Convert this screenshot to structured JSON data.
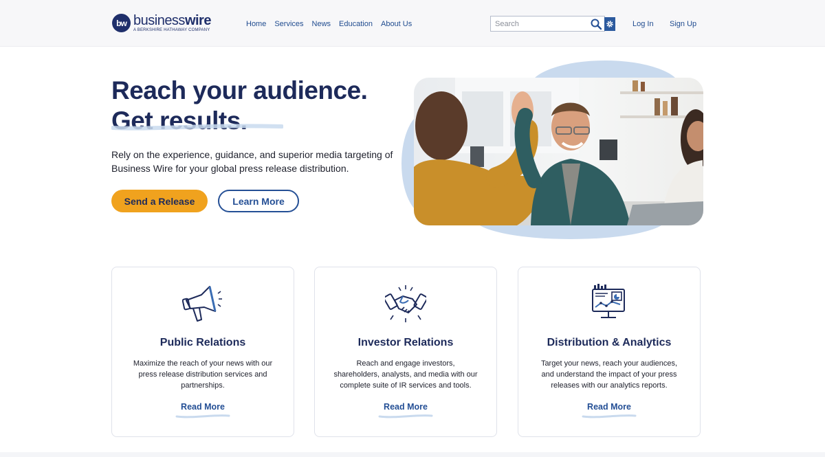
{
  "logo": {
    "mark": "bw",
    "word_light": "business",
    "word_bold": "wire",
    "tagline": "A BERKSHIRE HATHAWAY COMPANY"
  },
  "nav": {
    "items": [
      {
        "label": "Home"
      },
      {
        "label": "Services"
      },
      {
        "label": "News"
      },
      {
        "label": "Education"
      },
      {
        "label": "About Us"
      }
    ]
  },
  "search": {
    "placeholder": "Search",
    "value": ""
  },
  "auth": {
    "login": "Log In",
    "signup": "Sign Up"
  },
  "hero": {
    "title_line1": "Reach your audience.",
    "title_line2": "Get results.",
    "description": "Rely on the experience, guidance, and superior media targeting of Business Wire for your global press release distribution.",
    "primary_cta": "Send a Release",
    "secondary_cta": "Learn More"
  },
  "cards": [
    {
      "icon": "megaphone-icon",
      "title": "Public Relations",
      "text": "Maximize the reach of your news with our press release distribution services and partnerships.",
      "link": "Read More"
    },
    {
      "icon": "handshake-icon",
      "title": "Investor Relations",
      "text": "Reach and engage investors, shareholders, analysts, and media with our complete suite of IR services and tools.",
      "link": "Read More"
    },
    {
      "icon": "analytics-monitor-icon",
      "title": "Distribution & Analytics",
      "text": "Target your news, reach your audiences, and understand the impact of your press releases with our analytics reports.",
      "link": "Read More"
    }
  ],
  "colors": {
    "brand_navy": "#1d2a5a",
    "link_blue": "#244f95",
    "cta_orange": "#f0a21e",
    "blob_blue": "#c9daee"
  }
}
